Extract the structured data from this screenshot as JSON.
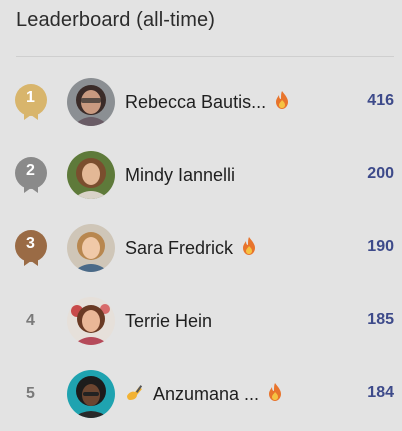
{
  "leaderboard": {
    "title": "Leaderboard (all-time)",
    "entries": [
      {
        "rank": "1",
        "medal": "gold",
        "medal_color": "#d8b56c",
        "name": "Rebecca Bautis...",
        "flame": true,
        "emoji_prefix": "",
        "score": "416"
      },
      {
        "rank": "2",
        "medal": "silver",
        "medal_color": "#8a8a8a",
        "name": "Mindy Iannelli",
        "flame": false,
        "emoji_prefix": "",
        "score": "200"
      },
      {
        "rank": "3",
        "medal": "bronze",
        "medal_color": "#9a6b45",
        "name": "Sara Fredrick",
        "flame": true,
        "emoji_prefix": "",
        "score": "190"
      },
      {
        "rank": "4",
        "medal": "none",
        "name": "Terrie Hein",
        "flame": false,
        "emoji_prefix": "",
        "score": "185"
      },
      {
        "rank": "5",
        "medal": "none",
        "name": "Anzumana ...",
        "flame": true,
        "emoji_prefix": "writing-hand",
        "score": "184"
      }
    ]
  },
  "colors": {
    "background": "#e3e3e3",
    "score": "#3d4a8a",
    "flame": "#e8742c"
  }
}
